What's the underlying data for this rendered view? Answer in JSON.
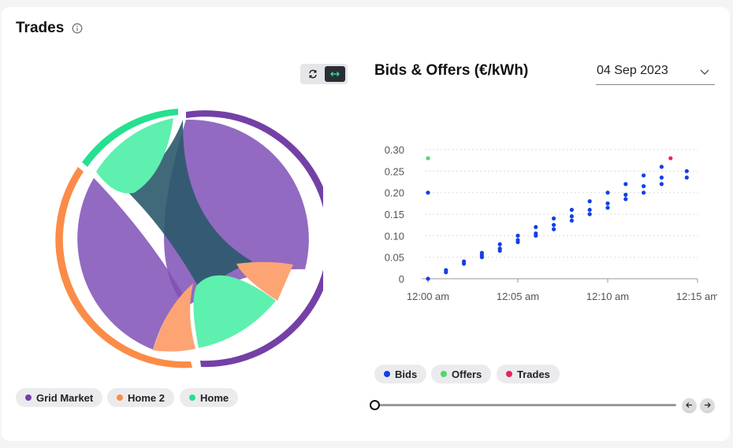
{
  "panel": {
    "title": "Trades"
  },
  "icons": {
    "info": "info-icon",
    "swap": "swap-icon",
    "expand": "expand-horizontal-icon",
    "chevron": "chevron-down-icon",
    "prev": "arrow-left-icon",
    "next": "arrow-right-icon"
  },
  "chord_legend": [
    {
      "label": "Grid Market",
      "color": "#7440a6"
    },
    {
      "label": "Home 2",
      "color": "#fb8c48"
    },
    {
      "label": "Home",
      "color": "#26e08f"
    }
  ],
  "bids_offers": {
    "title": "Bids & Offers (€/kWh)",
    "date": "04 Sep 2023"
  },
  "scatter_legend": [
    {
      "label": "Bids",
      "color": "#1240e6"
    },
    {
      "label": "Offers",
      "color": "#4fd86a"
    },
    {
      "label": "Trades",
      "color": "#e8245a"
    }
  ],
  "chart_data": {
    "type": "scatter",
    "title": "Bids & Offers (€/kWh)",
    "xlabel": "",
    "ylabel": "",
    "x_ticks": [
      "12:00 am",
      "12:05 am",
      "12:10 am",
      "12:15 am"
    ],
    "y_ticks": [
      "0",
      "0.05",
      "0.10",
      "0.15",
      "0.20",
      "0.25",
      "0.30"
    ],
    "xlim": [
      0,
      15
    ],
    "ylim": [
      0,
      0.3
    ],
    "grid": "horizontal dotted",
    "series": [
      {
        "name": "Bids",
        "color": "#1240e6",
        "points": [
          [
            0,
            0
          ],
          [
            0,
            0.2
          ],
          [
            1,
            0.015
          ],
          [
            1,
            0.02
          ],
          [
            2,
            0.035
          ],
          [
            2,
            0.04
          ],
          [
            3,
            0.05
          ],
          [
            3,
            0.055
          ],
          [
            3,
            0.06
          ],
          [
            4,
            0.065
          ],
          [
            4,
            0.07
          ],
          [
            4,
            0.08
          ],
          [
            5,
            0.085
          ],
          [
            5,
            0.09
          ],
          [
            5,
            0.1
          ],
          [
            6,
            0.1
          ],
          [
            6,
            0.105
          ],
          [
            6,
            0.12
          ],
          [
            7,
            0.115
          ],
          [
            7,
            0.125
          ],
          [
            7,
            0.14
          ],
          [
            8,
            0.135
          ],
          [
            8,
            0.145
          ],
          [
            8,
            0.16
          ],
          [
            9,
            0.15
          ],
          [
            9,
            0.16
          ],
          [
            9,
            0.18
          ],
          [
            10,
            0.165
          ],
          [
            10,
            0.175
          ],
          [
            10,
            0.2
          ],
          [
            11,
            0.185
          ],
          [
            11,
            0.195
          ],
          [
            11,
            0.22
          ],
          [
            12,
            0.2
          ],
          [
            12,
            0.215
          ],
          [
            12,
            0.24
          ],
          [
            13,
            0.22
          ],
          [
            13,
            0.235
          ],
          [
            13,
            0.26
          ],
          [
            14.4,
            0.235
          ],
          [
            14.4,
            0.25
          ]
        ]
      },
      {
        "name": "Offers",
        "color": "#4fd86a",
        "points": [
          [
            0,
            0.28
          ]
        ]
      },
      {
        "name": "Trades",
        "color": "#e8245a",
        "points": [
          [
            13.5,
            0.28
          ]
        ]
      }
    ]
  }
}
